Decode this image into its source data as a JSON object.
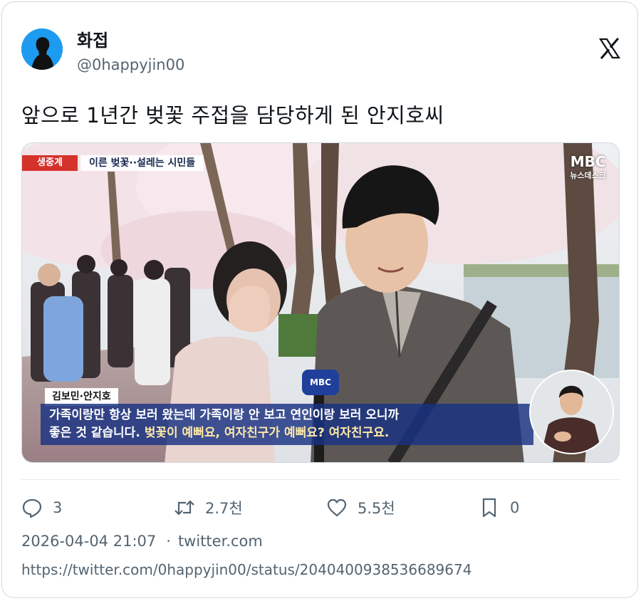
{
  "tweet": {
    "display_name": "화접",
    "handle": "@0happyjin00",
    "text": "앞으로 1년간 벚꽃 주접을 담당하게 된 안지호씨",
    "timestamp": "2026-04-04 21:07",
    "source": "twitter.com",
    "url": "https://twitter.com/0happyjin00/status/2040400938536689674"
  },
  "media": {
    "live_badge": "생중계",
    "topic": "이른 벚꽃··설레는 시민들",
    "broadcaster": "MBC",
    "broadcaster_sub": "뉴스데스크",
    "mic_label": "MBC",
    "speaker_names": "김보민·안지호",
    "subtitle_line1": "가족이랑만 항상 보러 왔는데 가족이랑 안 보고 연인이랑 보러 오니까",
    "subtitle_line2_a": "좋은 것 같습니다.",
    "subtitle_line2_b": "벚꽃이 예뻐요, 여자친구가 예뻐요? 여자친구요."
  },
  "actions": {
    "reply_count": "3",
    "retweet_count": "2.7천",
    "like_count": "5.5천",
    "bookmark_count": "0"
  },
  "icons": {
    "reply": "reply-icon",
    "retweet": "retweet-icon",
    "like": "heart-icon",
    "bookmark": "bookmark-icon",
    "platform": "x-logo-icon"
  },
  "colors": {
    "avatar_bg": "#1d9bf0",
    "muted_text": "#536471",
    "live_red": "#d6322c",
    "subtitle_bg": "#183282"
  }
}
